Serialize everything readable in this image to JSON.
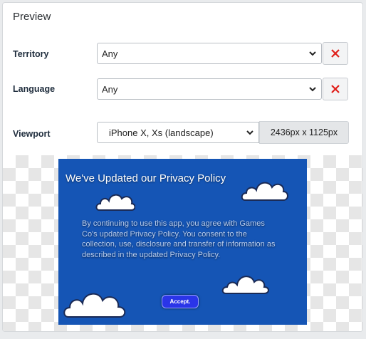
{
  "panel": {
    "title": "Preview"
  },
  "territory": {
    "label": "Territory",
    "value": "Any"
  },
  "language": {
    "label": "Language",
    "value": "Any"
  },
  "viewport": {
    "label": "Viewport",
    "value": "iPhone X, Xs (landscape)",
    "dimensions": "2436px x 1125px"
  },
  "preview": {
    "title": "We've Updated our Privacy Policy",
    "body": "By continuing to use this app, you agree with Games Co's updated Privacy Policy. You consent to the collection, use, disclosure and transfer of information as described in the updated Privacy Policy.",
    "accept_label": "Accept.",
    "background_color": "#1555b5"
  },
  "colors": {
    "clear_icon": "#e0201b"
  }
}
